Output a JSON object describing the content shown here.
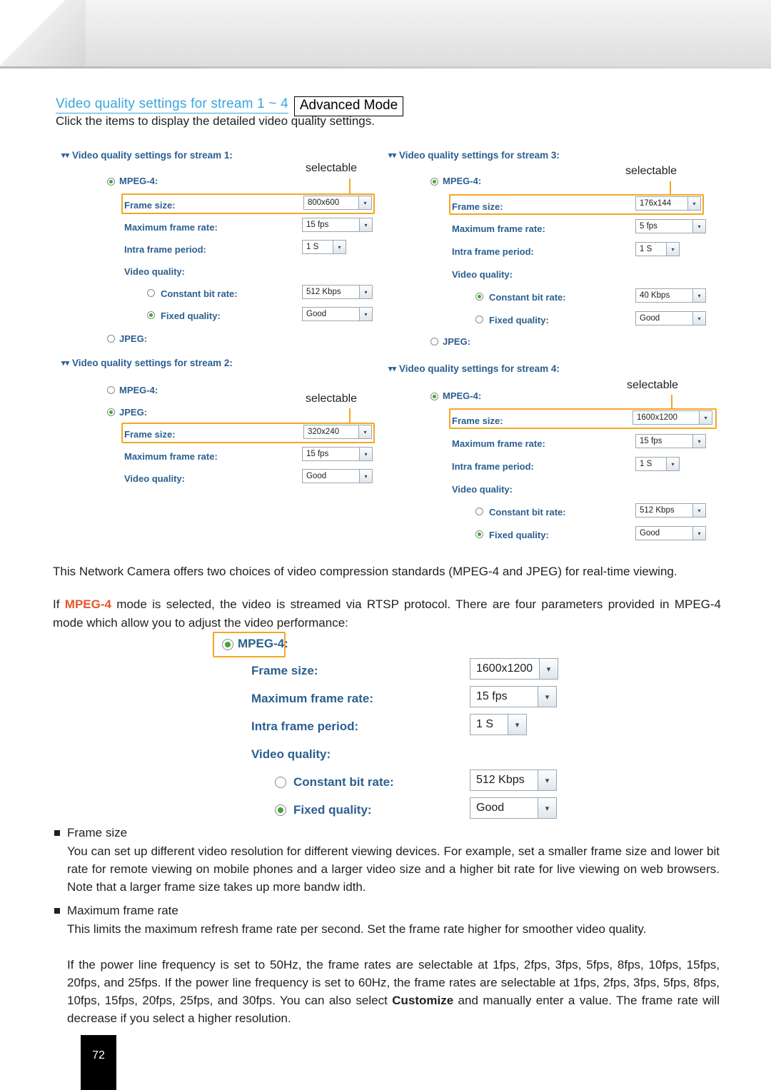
{
  "header": {
    "link_text": "Video quality settings for stream 1 ~ 4",
    "advanced_mode": "Advanced Mode",
    "subtitle": "Click the items to display the detailed video quality settings."
  },
  "screenshot": {
    "selectable_note": "selectable",
    "streams": [
      {
        "title": "Video quality settings for stream 1:",
        "mpeg4_label": "MPEG-4:",
        "mpeg4_selected": true,
        "jpeg_label": "JPEG:",
        "jpeg_selected": false,
        "rows": [
          {
            "label": "Frame size:",
            "value": "800x600"
          },
          {
            "label": "Maximum frame rate:",
            "value": "15 fps"
          },
          {
            "label": "Intra frame period:",
            "value": "1 S"
          }
        ],
        "video_quality_label": "Video quality:",
        "cbr_label": "Constant bit rate:",
        "cbr_value": "512 Kbps",
        "cbr_selected": false,
        "fixed_label": "Fixed quality:",
        "fixed_value": "Good",
        "fixed_selected": true
      },
      {
        "title": "Video quality settings for stream 2:",
        "mpeg4_label": "MPEG-4:",
        "mpeg4_selected": false,
        "jpeg_label": "JPEG:",
        "jpeg_selected": true,
        "rows": [
          {
            "label": "Frame size:",
            "value": "320x240"
          },
          {
            "label": "Maximum frame rate:",
            "value": "15 fps"
          },
          {
            "label": "Video quality:",
            "value": "Good"
          }
        ]
      },
      {
        "title": "Video quality settings for stream 3:",
        "mpeg4_label": "MPEG-4:",
        "mpeg4_selected": true,
        "jpeg_label": "JPEG:",
        "jpeg_selected": false,
        "rows": [
          {
            "label": "Frame size:",
            "value": "176x144"
          },
          {
            "label": "Maximum frame rate:",
            "value": "5 fps"
          },
          {
            "label": "Intra frame period:",
            "value": "1 S"
          }
        ],
        "video_quality_label": "Video quality:",
        "cbr_label": "Constant bit rate:",
        "cbr_value": "40 Kbps",
        "cbr_selected": true,
        "fixed_label": "Fixed quality:",
        "fixed_value": "Good",
        "fixed_selected": false
      },
      {
        "title": "Video quality settings for stream 4:",
        "mpeg4_label": "MPEG-4:",
        "mpeg4_selected": true,
        "rows": [
          {
            "label": "Frame size:",
            "value": "1600x1200"
          },
          {
            "label": "Maximum frame rate:",
            "value": "15 fps"
          },
          {
            "label": "Intra frame period:",
            "value": "1 S"
          }
        ],
        "video_quality_label": "Video quality:",
        "cbr_label": "Constant bit rate:",
        "cbr_value": "512 Kbps",
        "cbr_selected": false,
        "fixed_label": "Fixed quality:",
        "fixed_value": "Good",
        "fixed_selected": true
      }
    ]
  },
  "body": {
    "p1": "This Network Camera offers two choices of video compression standards (MPEG-4 and JPEG) for real-time viewing.",
    "p2_pre": "If ",
    "p2_mpeg": "MPEG-4",
    "p2_post": " mode is selected, the video is streamed via RTSP protocol. There are four parameters provided in MPEG-4 mode which allow you to adjust the video performance:"
  },
  "big_panel": {
    "mpeg4_label": "MPEG-4:",
    "mpeg4_selected": true,
    "rows": [
      {
        "label": "Frame size:",
        "value": "1600x1200"
      },
      {
        "label": "Maximum frame rate:",
        "value": "15 fps"
      },
      {
        "label": "Intra frame period:",
        "value": "1 S"
      }
    ],
    "video_quality_label": "Video quality:",
    "cbr_label": "Constant bit rate:",
    "cbr_value": "512 Kbps",
    "cbr_selected": false,
    "fixed_label": "Fixed quality:",
    "fixed_value": "Good",
    "fixed_selected": true
  },
  "bullets": [
    {
      "title": "Frame size",
      "body": "You can set up different video resolution for different viewing devices. For example, set a smaller frame size and lower bit rate for remote viewing on mobile phones and a larger video size and a higher bit rate for live viewing on web browsers. Note that a larger frame size takes up more bandw idth."
    },
    {
      "title": "Maximum frame rate",
      "body_1": "This limits the maximum refresh frame rate per second. Set the frame rate higher for smoother video quality.",
      "body_2_pre": "If the power line frequency is set to 50Hz, the frame rates are selectable at 1fps, 2fps, 3fps, 5fps, 8fps, 10fps, 15fps, 20fps, and 25fps. If the power line frequency is set to 60Hz, the frame rates are selectable at 1fps, 2fps, 3fps, 5fps, 8fps, 10fps, 15fps, 20fps, 25fps, and 30fps. You can also select ",
      "body_2_bold": "Customize",
      "body_2_post": " and manually enter a value. The frame rate will decrease if you select a higher resolution."
    }
  ],
  "footer": {
    "page_number": "72"
  }
}
